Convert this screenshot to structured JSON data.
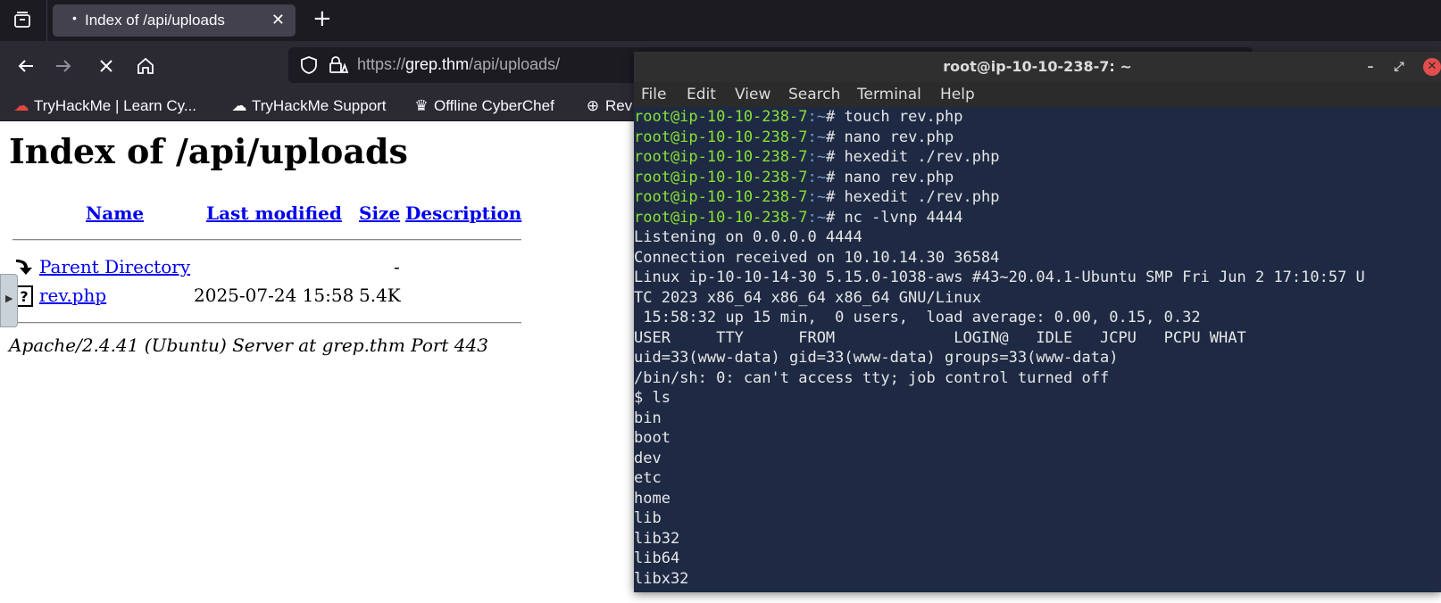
{
  "browser": {
    "tab": {
      "title": "Index of /api/uploads"
    },
    "url": {
      "scheme": "https://",
      "host": "grep.thm",
      "path": "/api/uploads/"
    },
    "bookmarks": [
      {
        "label": "TryHackMe | Learn Cy...",
        "icon": "tryhackme-icon"
      },
      {
        "label": "TryHackMe Support",
        "icon": "cloud-icon"
      },
      {
        "label": "Offline CyberChef",
        "icon": "chef-icon"
      },
      {
        "label": "Rev",
        "icon": "globe-icon"
      }
    ]
  },
  "page": {
    "heading": "Index of /api/uploads",
    "columns": {
      "name": "Name",
      "modified": "Last modified",
      "size": "Size",
      "description": "Description"
    },
    "rows": [
      {
        "name": "Parent Directory",
        "modified": "",
        "size": "-",
        "icon": "back-icon"
      },
      {
        "name": "rev.php",
        "modified": "2025-07-24 15:58",
        "size": "5.4K",
        "icon": "unknown-file-icon"
      }
    ],
    "address": "Apache/2.4.41 (Ubuntu) Server at grep.thm Port 443"
  },
  "terminal": {
    "title": "root@ip-10-10-238-7: ~",
    "menu": [
      "File",
      "Edit",
      "View",
      "Search",
      "Terminal",
      "Help"
    ],
    "prompt_user": "root@ip-10-10-238-7",
    "prompt_cwd": ":~",
    "prompt_symbol": "# ",
    "commands": [
      "touch rev.php",
      "nano rev.php",
      "hexedit ./rev.php",
      "nano rev.php",
      "hexedit ./rev.php",
      "nc -lvnp 4444"
    ],
    "output": [
      "Listening on 0.0.0.0 4444",
      "Connection received on 10.10.14.30 36584",
      "Linux ip-10-10-14-30 5.15.0-1038-aws #43~20.04.1-Ubuntu SMP Fri Jun 2 17:10:57 U",
      "TC 2023 x86_64 x86_64 x86_64 GNU/Linux",
      " 15:58:32 up 15 min,  0 users,  load average: 0.00, 0.15, 0.32",
      "USER     TTY      FROM             LOGIN@   IDLE   JCPU   PCPU WHAT",
      "uid=33(www-data) gid=33(www-data) groups=33(www-data)",
      "/bin/sh: 0: can't access tty; job control turned off",
      "$ ls",
      "bin",
      "boot",
      "dev",
      "etc",
      "home",
      "lib",
      "lib32",
      "lib64",
      "libx32"
    ]
  }
}
